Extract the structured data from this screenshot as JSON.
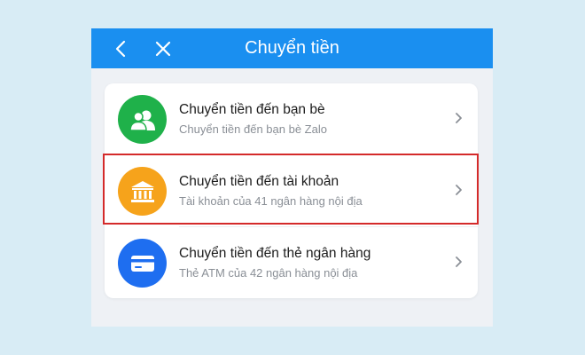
{
  "header": {
    "title": "Chuyển tiền",
    "back_icon": "chevron-left-icon",
    "close_icon": "close-icon",
    "color": "#1a8ff0"
  },
  "options": [
    {
      "title": "Chuyển tiền đến bạn bè",
      "subtitle": "Chuyển tiền đến bạn bè Zalo",
      "icon": "friends-icon",
      "color": "#1fb14a"
    },
    {
      "title": "Chuyển tiền đến tài khoản",
      "subtitle": "Tài khoản của 41 ngân hàng nội địa",
      "icon": "bank-icon",
      "color": "#f6a31b"
    },
    {
      "title": "Chuyển tiền đến thẻ ngân hàng",
      "subtitle": "Thẻ ATM của 42 ngân hàng nội địa",
      "icon": "card-icon",
      "color": "#1e6ef0"
    }
  ],
  "highlight_color": "#d42a2a"
}
